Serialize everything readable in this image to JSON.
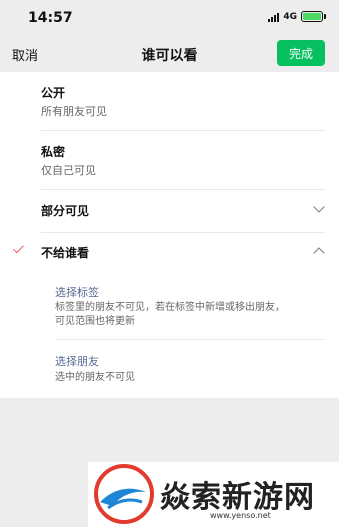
{
  "status_bar": {
    "time": "14:57",
    "network": "4G",
    "icons": [
      "signal-icon",
      "battery-icon"
    ]
  },
  "nav": {
    "cancel_label": "取消",
    "title": "谁可以看",
    "done_label": "完成",
    "done_color": "#07c160"
  },
  "options": [
    {
      "title": "公开",
      "desc": "所有朋友可见",
      "selected": false
    },
    {
      "title": "私密",
      "desc": "仅自己可见",
      "selected": false
    },
    {
      "title": "部分可见",
      "icon": "chevron-down-icon",
      "selected": false
    },
    {
      "title": "不给谁看",
      "icon": "chevron-up-icon",
      "selected": true
    }
  ],
  "sub_options": [
    {
      "title": "选择标签",
      "desc_line1": "标签里的朋友不可见，若在标签中新增或移出朋友，",
      "desc_line2": "可见范围也将更新"
    },
    {
      "title": "选择朋友",
      "desc": "选中的朋友不可见"
    }
  ],
  "watermark": {
    "text": "焱索新游网",
    "url": "www.yenso.net"
  },
  "colors": {
    "accent": "#07c160",
    "check": "#fa5151",
    "link": "#576b95"
  }
}
